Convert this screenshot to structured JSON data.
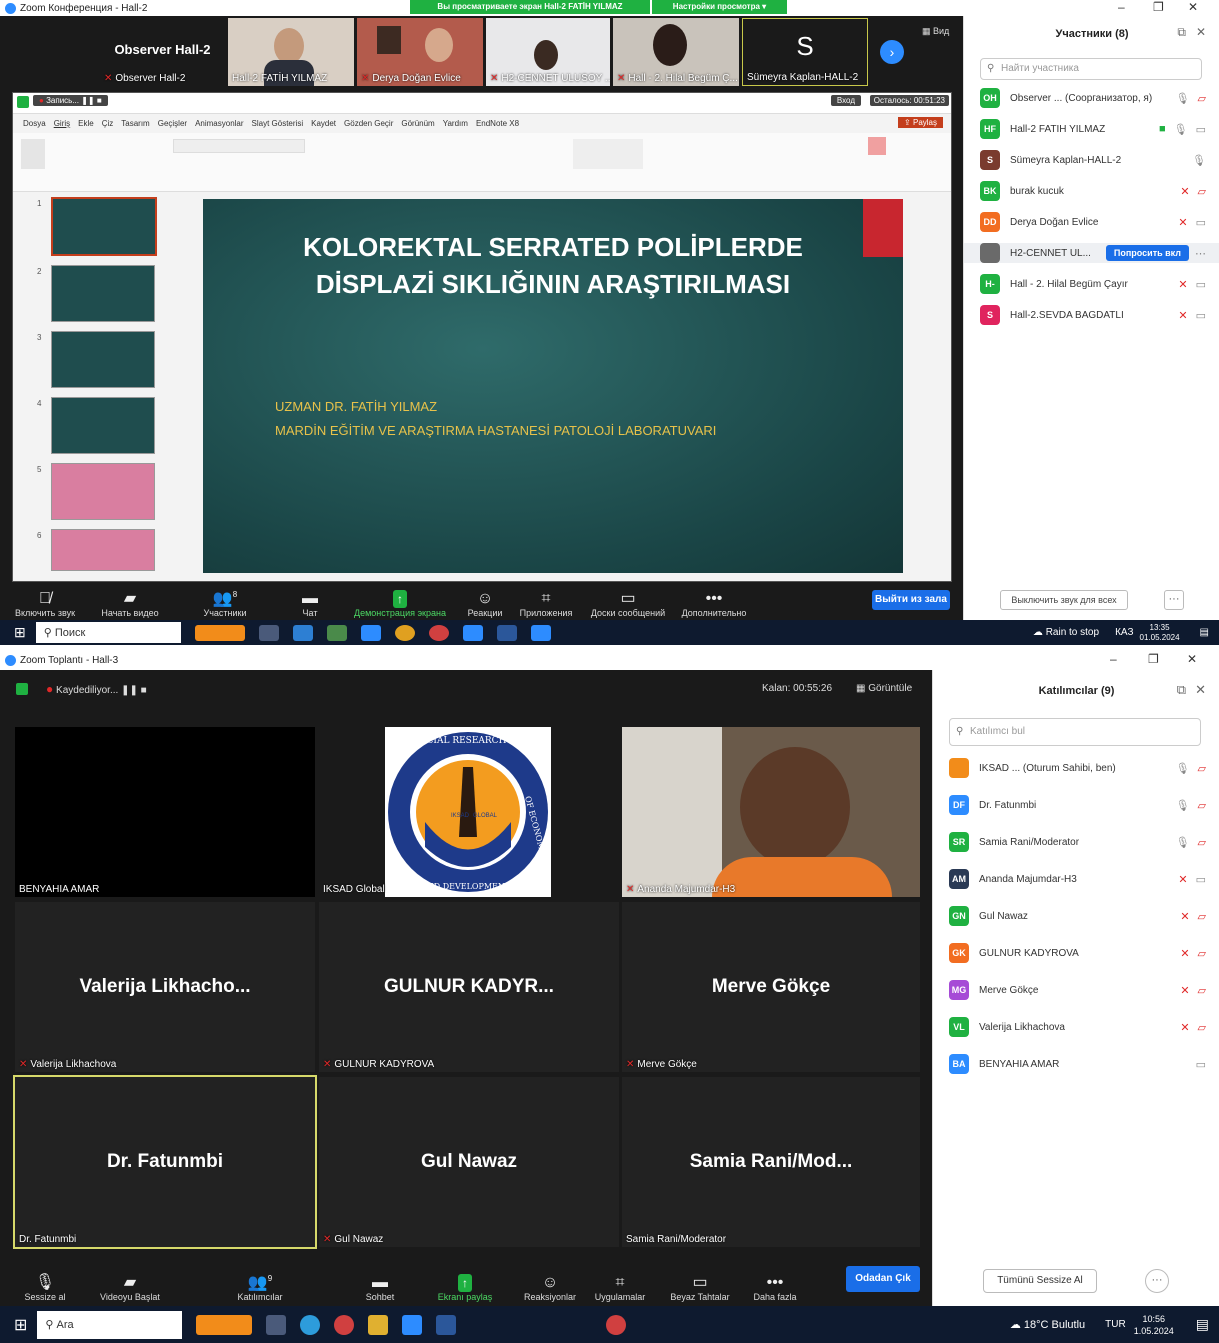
{
  "top_window": {
    "title": "Zoom Конференция - Hall-2",
    "banner_view": "Вы просматриваете экран Hall-2 FATİH YILMAZ",
    "banner_options": "Настройки просмотра",
    "view_label": "Вид",
    "gallery": [
      {
        "name": "Observer Hall-2",
        "tag": "Observer Hall-2"
      },
      {
        "name": "",
        "tag": "Hall-2 FATİH YILMAZ"
      },
      {
        "name": "",
        "tag": "Derya Doğan Evlice"
      },
      {
        "name": "",
        "tag": "H2-CENNET ULUSOY ..."
      },
      {
        "name": "",
        "tag": "Hall - 2. Hilal Begüm Ç..."
      },
      {
        "name": "S",
        "tag": "Sümeyra Kaplan-HALL-2"
      }
    ],
    "ppt": {
      "recording": "Запись...",
      "ribbon_tabs": [
        "Dosya",
        "Giriş",
        "Ekle",
        "Çiz",
        "Tasarım",
        "Geçişler",
        "Animasyonlar",
        "Slayt Gösterisi",
        "Kaydet",
        "Gözden Geçir",
        "Görünüm",
        "Yardım",
        "EndNote X8"
      ],
      "share_button": "Paylaş",
      "remaining": "Осталось: 00:51:23",
      "login": "Вход",
      "slide_title": "KOLOREKTAL SERRATED POLİPLERDE DİSPLAZİ SIKLIĞININ ARAŞTIRILMASI",
      "slide_author": "UZMAN DR. FATİH YILMAZ",
      "slide_institution": "MARDİN EĞİTİM VE ARAŞTIRMA HASTANESİ PATOLOJİ LABORATUVARI",
      "slide_numbers": [
        "1",
        "2",
        "3",
        "4",
        "5",
        "6"
      ]
    },
    "toolbar": [
      {
        "label": "Включить звук",
        "icon": "mic-muted-icon"
      },
      {
        "label": "Начать видео",
        "icon": "video-off-icon"
      },
      {
        "label": "Участники",
        "icon": "participants-icon",
        "count": "8"
      },
      {
        "label": "Чат",
        "icon": "chat-icon"
      },
      {
        "label": "Демонстрация экрана",
        "icon": "share-screen-icon"
      },
      {
        "label": "Реакции",
        "icon": "reactions-icon"
      },
      {
        "label": "Приложения",
        "icon": "apps-icon"
      },
      {
        "label": "Доски сообщений",
        "icon": "whiteboard-icon"
      },
      {
        "label": "Дополнительно",
        "icon": "more-icon"
      }
    ],
    "leave_button": "Выйти из зала",
    "panel": {
      "title": "Участники (8)",
      "search_placeholder": "Найти участника",
      "participants": [
        {
          "initials": "OH",
          "color": "#1fb141",
          "name": "Observer ... (Соорганизатор, я)"
        },
        {
          "initials": "HF",
          "color": "#1fb141",
          "name": "Hall-2 FATİH YILMAZ"
        },
        {
          "initials": "S",
          "color": "#7a3b2e",
          "name": "Sümeyra Kaplan-HALL-2"
        },
        {
          "initials": "BK",
          "color": "#1fb141",
          "name": "burak kucuk"
        },
        {
          "initials": "DD",
          "color": "#f26d21",
          "name": "Derya Doğan Evlice"
        },
        {
          "initials": "",
          "color": "#6a6a6a",
          "name": "H2-CENNET UL..."
        },
        {
          "initials": "H-",
          "color": "#1fb141",
          "name": "Hall - 2. Hilal Begüm Çayır"
        },
        {
          "initials": "S",
          "color": "#e0245e",
          "name": "Hall-2.SEVDA BAGDATLI"
        }
      ],
      "ask_button": "Попросить вкл",
      "mute_all": "Выключить звук для всех"
    },
    "taskbar": {
      "search": "Поиск",
      "weather": "Rain to stop",
      "lang": "КАЗ",
      "time": "13:35",
      "date": "01.05.2024"
    }
  },
  "bottom_window": {
    "title": "Zoom Toplantı - Hall-3",
    "recording": "Kaydediliyor...",
    "remaining": "Kalan: 00:55:26",
    "view_label": "Görüntüle",
    "tiles": [
      {
        "big": "",
        "tag": "BENYAHIA AMAR",
        "muted": false
      },
      {
        "big": "",
        "tag": "IKSAD Global",
        "muted": false
      },
      {
        "big": "",
        "tag": "Ananda Majumdar-H3",
        "muted": true
      },
      {
        "big": "Valerija  Likhacho...",
        "tag": "Valerija Likhachova",
        "muted": true
      },
      {
        "big": "GULNUR  KADYR...",
        "tag": "GULNUR KADYROVA",
        "muted": true
      },
      {
        "big": "Merve Gökçe",
        "tag": "Merve Gökçe",
        "muted": true
      },
      {
        "big": "Dr. Fatunmbi",
        "tag": "Dr. Fatunmbi",
        "muted": false
      },
      {
        "big": "Gul Nawaz",
        "tag": "Gul Nawaz",
        "muted": true
      },
      {
        "big": "Samia  Rani/Mod...",
        "tag": "Samia Rani/Moderator",
        "muted": false
      }
    ],
    "logo": {
      "arc_top": "SOCIAL RESEARCH ★ INSTITUTE",
      "arc_right": "OF ECONOMIC",
      "arc_bottom": "AND DEVELOPMENT",
      "center_left": "IKSAD",
      "center_right": "GLOBAL"
    },
    "toolbar": [
      {
        "label": "Sessize al",
        "icon": "mic-icon"
      },
      {
        "label": "Videoyu Başlat",
        "icon": "video-off-icon"
      },
      {
        "label": "Katılımcılar",
        "icon": "participants-icon",
        "count": "9"
      },
      {
        "label": "Sohbet",
        "icon": "chat-icon"
      },
      {
        "label": "Ekranı paylaş",
        "icon": "share-screen-icon"
      },
      {
        "label": "Reaksiyonlar",
        "icon": "reactions-icon"
      },
      {
        "label": "Uygulamalar",
        "icon": "apps-icon"
      },
      {
        "label": "Beyaz Tahtalar",
        "icon": "whiteboard-icon"
      },
      {
        "label": "Daha fazla",
        "icon": "more-icon"
      }
    ],
    "leave_button": "Odadan Çık",
    "panel": {
      "title": "Katılımcılar (9)",
      "search_placeholder": "Katılımcı bul",
      "participants": [
        {
          "initials": "",
          "color": "#f28c1a",
          "name": "IKSAD ... (Oturum Sahibi, ben)"
        },
        {
          "initials": "DF",
          "color": "#2d8cff",
          "name": "Dr. Fatunmbi"
        },
        {
          "initials": "SR",
          "color": "#1fb141",
          "name": "Samia Rani/Moderator"
        },
        {
          "initials": "AM",
          "color": "#2a3a55",
          "name": "Ananda Majumdar-H3"
        },
        {
          "initials": "GN",
          "color": "#1fb141",
          "name": "Gul Nawaz"
        },
        {
          "initials": "GK",
          "color": "#f26d21",
          "name": "GULNUR KADYROVA"
        },
        {
          "initials": "MG",
          "color": "#a64bd6",
          "name": "Merve Gökçe"
        },
        {
          "initials": "VL",
          "color": "#1fb141",
          "name": "Valerija Likhachova"
        },
        {
          "initials": "BA",
          "color": "#2d8cff",
          "name": "BENYAHIA AMAR"
        }
      ],
      "mute_all": "Tümünü Sessize Al"
    },
    "taskbar": {
      "search": "Ara",
      "weather": "18°C  Bulutlu",
      "lang": "TUR",
      "time": "10:56",
      "date": "1.05.2024"
    }
  }
}
